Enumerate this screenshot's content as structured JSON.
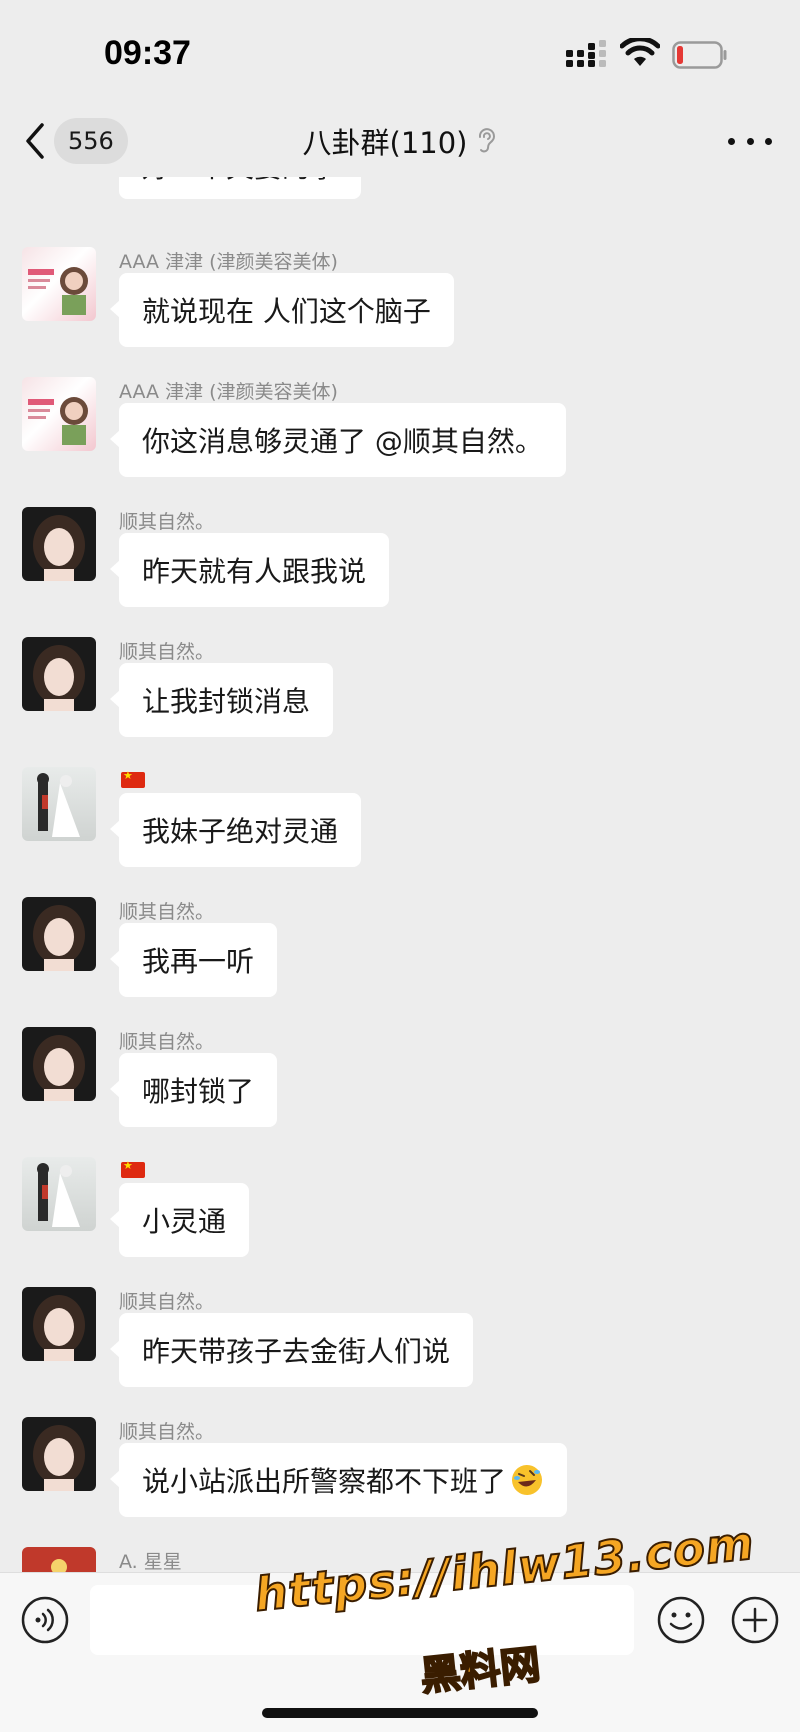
{
  "status_bar": {
    "time": "09:37"
  },
  "nav": {
    "unread_count": "556",
    "title": "八卦群(110)"
  },
  "messages": [
    {
      "sender": "",
      "text": "好一个夫妻的事",
      "avatar": "grey-avatar"
    },
    {
      "sender": "AAA 津津 (津颜美容美体)",
      "text": "就说现在 人们这个脑子",
      "avatar": "salon-avatar"
    },
    {
      "sender": "AAA 津津 (津颜美容美体)",
      "text": "你这消息够灵通了 @顺其自然。",
      "avatar": "salon-avatar"
    },
    {
      "sender": "顺其自然。",
      "text": "昨天就有人跟我说",
      "avatar": "girl-avatar"
    },
    {
      "sender": "顺其自然。",
      "text": "让我封锁消息",
      "avatar": "girl-avatar"
    },
    {
      "sender": "",
      "text": "我妹子绝对灵通",
      "avatar": "couple-avatar",
      "sender_flag": "china-flag"
    },
    {
      "sender": "顺其自然。",
      "text": "我再一听",
      "avatar": "girl-avatar"
    },
    {
      "sender": "顺其自然。",
      "text": "哪封锁了",
      "avatar": "girl-avatar"
    },
    {
      "sender": "",
      "text": "小灵通",
      "avatar": "couple-avatar",
      "sender_flag": "china-flag"
    },
    {
      "sender": "顺其自然。",
      "text": "昨天带孩子去金街人们说",
      "avatar": "girl-avatar"
    },
    {
      "sender": "顺其自然。",
      "text": "说小站派出所警察都不下班了",
      "avatar": "girl-avatar",
      "emoji": "rolling-laughing-emoji"
    },
    {
      "sender": "A.   星星",
      "text": "",
      "avatar": "red-avatar"
    }
  ],
  "input": {
    "value": "",
    "placeholder": ""
  },
  "watermark": {
    "line1": "https://ihlw13.com",
    "line2": "黑料网"
  },
  "colors": {
    "background": "#ededed",
    "bubble": "#ffffff",
    "sender_name": "#8a8a8a",
    "watermark": "#f5a623"
  }
}
